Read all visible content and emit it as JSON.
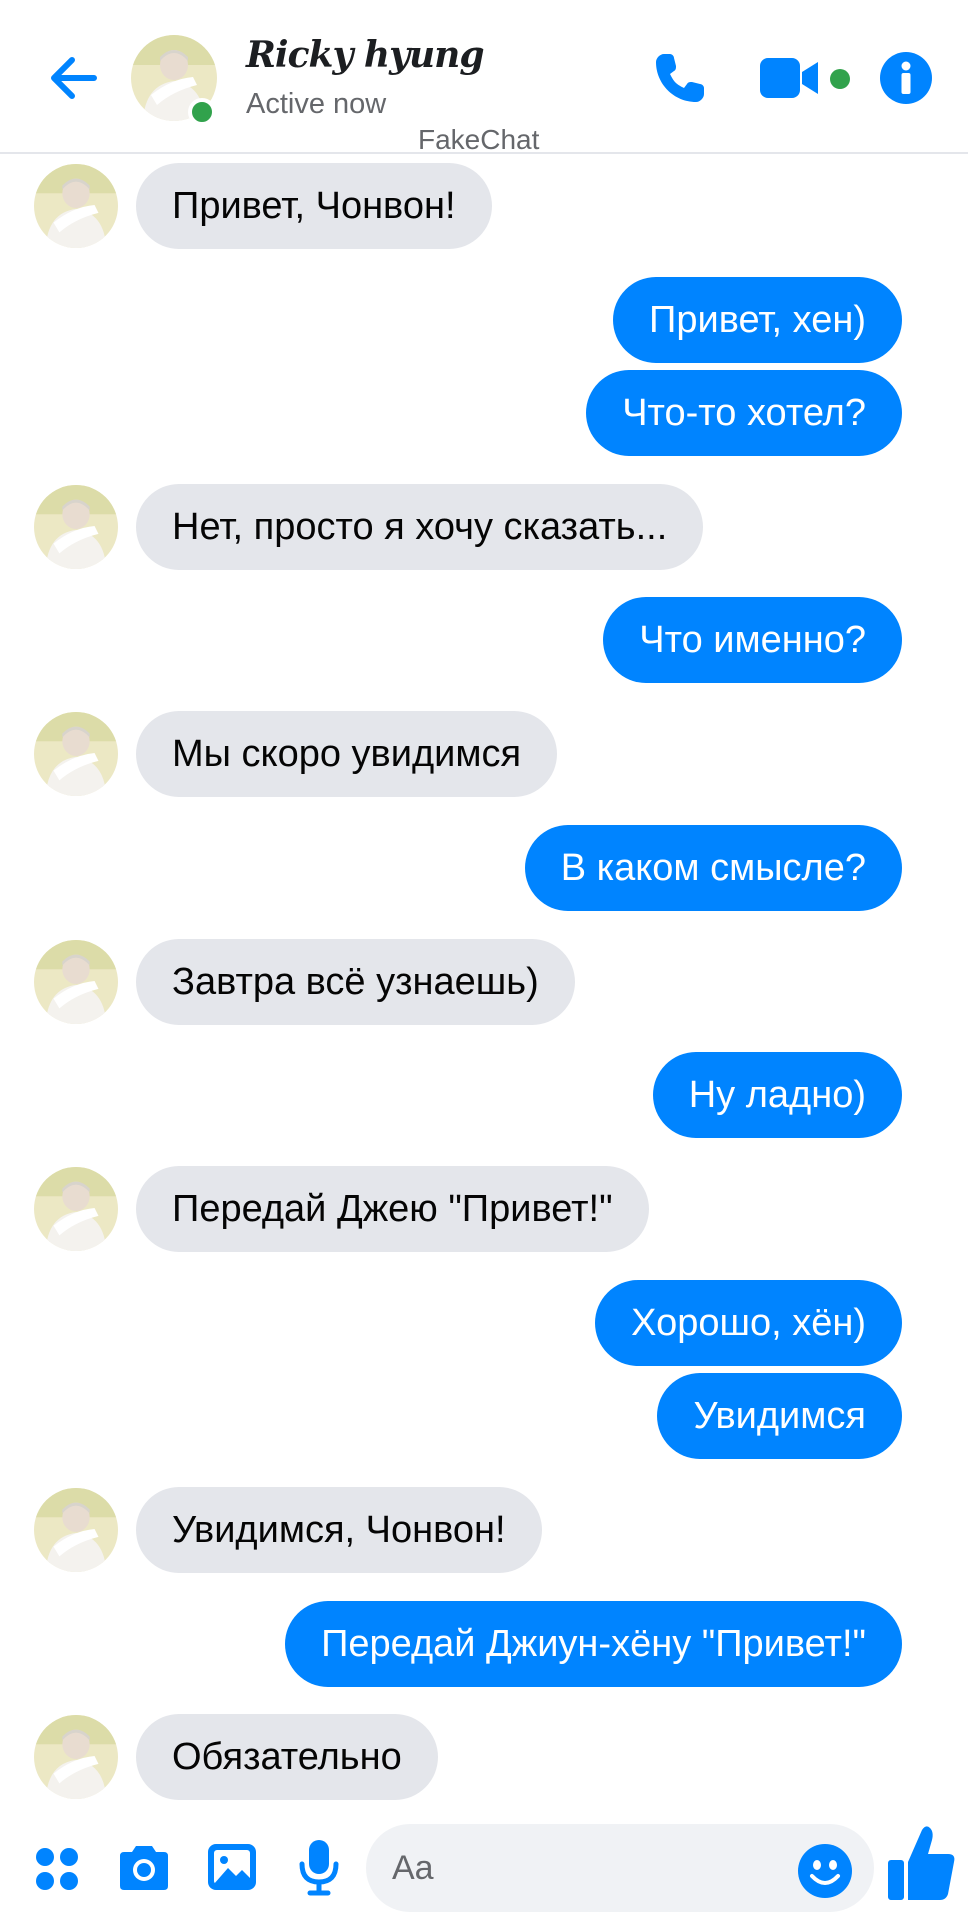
{
  "header": {
    "name": "Ricky hyung",
    "status": "Active now",
    "watermark": "FakeChat"
  },
  "composer": {
    "placeholder": "Aa"
  },
  "colors": {
    "accent": "#0084ff",
    "incoming_bubble": "#e4e6eb",
    "online": "#31a24c"
  },
  "icons": [
    "back-arrow-icon",
    "phone-icon",
    "video-camera-icon",
    "info-icon",
    "apps-grid-icon",
    "camera-icon",
    "gallery-icon",
    "microphone-icon",
    "emoji-icon",
    "thumbs-up-icon"
  ],
  "messages": [
    {
      "side": "in",
      "text": "Привет, Чонвон!"
    },
    {
      "side": "out",
      "text": "Привет, хен)"
    },
    {
      "side": "out",
      "text": "Что-то хотел?"
    },
    {
      "side": "in",
      "text": "Нет, просто я хочу сказать..."
    },
    {
      "side": "out",
      "text": "Что именно?"
    },
    {
      "side": "in",
      "text": "Мы скоро увидимся"
    },
    {
      "side": "out",
      "text": "В каком смысле?"
    },
    {
      "side": "in",
      "text": "Завтра всё узнаешь)"
    },
    {
      "side": "out",
      "text": "Ну ладно)"
    },
    {
      "side": "in",
      "text": "Передай Джею \"Привет!\""
    },
    {
      "side": "out",
      "text": "Хорошо, хён)"
    },
    {
      "side": "out",
      "text": "Увидимся"
    },
    {
      "side": "in",
      "text": "Увидимся, Чонвон!"
    },
    {
      "side": "out",
      "text": "Передай Джиун-хёну \"Привет!\""
    },
    {
      "side": "in",
      "text": "Обязательно"
    }
  ]
}
